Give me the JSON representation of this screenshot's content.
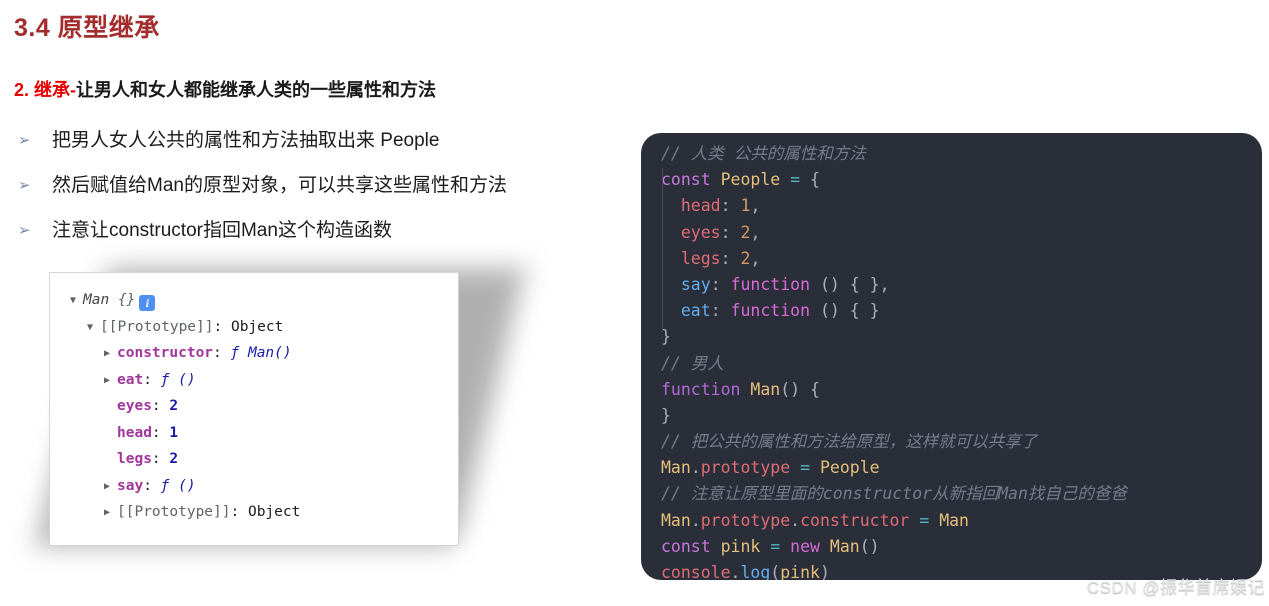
{
  "slide": {
    "title": "3.4 原型继承",
    "title_color": "#a32c2c",
    "subheading_highlight": "2. 继承-",
    "subheading_rest": "让男人和女人都能继承人类的一些属性和方法",
    "highlight_color": "#e60000",
    "bullet_marker": "➢",
    "bullets": [
      {
        "text": "把男人女人公共的属性和方法抽取出来 People"
      },
      {
        "text": "然后赋值给Man的原型对象，可以共享这些属性和方法"
      },
      {
        "text": "注意让constructor指回Man这个构造函数"
      }
    ]
  },
  "console": {
    "root_label": "Man",
    "root_braces": "{}",
    "info_icon_glyph": "i",
    "expand_open_glyph": "▼",
    "expand_closed_glyph": "▶",
    "rows": [
      {
        "indent": 0,
        "toggle": "▼",
        "label": "Man",
        "braces": "{}",
        "kind": "root"
      },
      {
        "indent": 1,
        "toggle": "▼",
        "key": "[[Prototype]]",
        "sep": ": ",
        "value": "Object",
        "kind": "proto"
      },
      {
        "indent": 2,
        "toggle": "▶",
        "key": "constructor",
        "sep": ": ",
        "value": "ƒ Man()",
        "kind": "fn"
      },
      {
        "indent": 2,
        "toggle": "▶",
        "key": "eat",
        "sep": ": ",
        "value": "ƒ ()",
        "kind": "fn"
      },
      {
        "indent": 2,
        "toggle": "",
        "key": "eyes",
        "sep": ": ",
        "value": "2",
        "kind": "num"
      },
      {
        "indent": 2,
        "toggle": "",
        "key": "head",
        "sep": ": ",
        "value": "1",
        "kind": "num"
      },
      {
        "indent": 2,
        "toggle": "",
        "key": "legs",
        "sep": ": ",
        "value": "2",
        "kind": "num"
      },
      {
        "indent": 2,
        "toggle": "▶",
        "key": "say",
        "sep": ": ",
        "value": "ƒ ()",
        "kind": "fn"
      },
      {
        "indent": 2,
        "toggle": "▶",
        "key": "[[Prototype]]",
        "sep": ": ",
        "value": "Object",
        "kind": "proto"
      }
    ]
  },
  "code": {
    "background": "#2a2e39",
    "lines": [
      "// 人类 公共的属性和方法",
      "const People = {",
      "  head: 1,",
      "  eyes: 2,",
      "  legs: 2,",
      "  say: function () { },",
      "  eat: function () { }",
      "}",
      "// 男人",
      "function Man() {",
      "}",
      "// 把公共的属性和方法给原型，这样就可以共享了",
      "Man.prototype = People",
      "// 注意让原型里面的constructor从新指回Man找自己的爸爸",
      "Man.prototype.constructor = Man",
      "const pink = new Man()",
      "console.log(pink)"
    ],
    "tokens": {
      "comment1": "// 人类 公共的属性和方法",
      "comment2": "// 男人",
      "comment3": "// 把公共的属性和方法给原型，这样就可以共享了",
      "comment4": "// 注意让原型里面的constructor从新指回Man找自己的爸爸",
      "kw_const": "const",
      "kw_function": "function",
      "kw_new": "new",
      "id_People": "People",
      "id_Man": "Man",
      "id_pink": "pink",
      "id_console": "console",
      "id_log": "log",
      "prop_head": "head",
      "prop_eyes": "eyes",
      "prop_legs": "legs",
      "prop_say": "say",
      "prop_eat": "eat",
      "prop_prototype": "prototype",
      "prop_constructor": "constructor",
      "num_1": "1",
      "num_2": "2",
      "eq": "=",
      "open_brace": "{",
      "close_brace": "}",
      "comma": ",",
      "colon": ":",
      "parens": "()",
      "empty_body": "{ }"
    },
    "reflection_text": "console.log(pink)"
  },
  "watermark": {
    "text": "CSDN @振华首席娱记"
  }
}
